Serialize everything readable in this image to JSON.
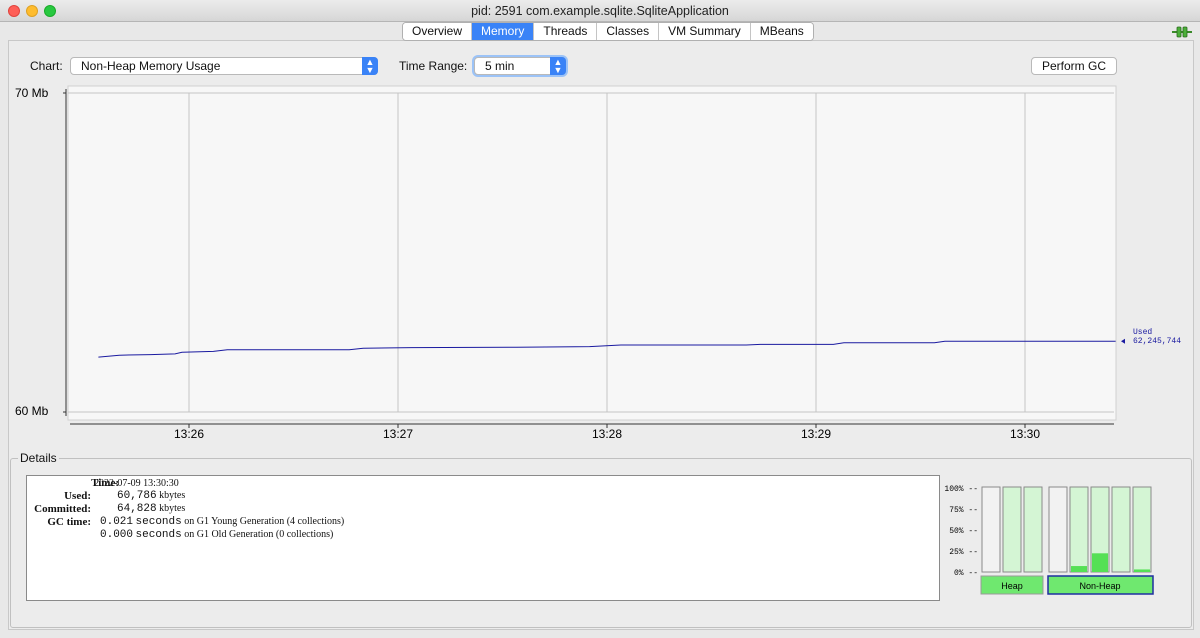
{
  "window": {
    "title": "pid: 2591 com.example.sqlite.SqliteApplication"
  },
  "tabs": [
    {
      "label": "Overview",
      "active": false
    },
    {
      "label": "Memory",
      "active": true
    },
    {
      "label": "Threads",
      "active": false
    },
    {
      "label": "Classes",
      "active": false
    },
    {
      "label": "VM Summary",
      "active": false
    },
    {
      "label": "MBeans",
      "active": false
    }
  ],
  "controls": {
    "chart_label": "Chart:",
    "chart_value": "Non-Heap Memory Usage",
    "time_range_label": "Time Range:",
    "time_range_value": "5 min",
    "perform_gc": "Perform GC"
  },
  "chart_data": {
    "type": "line",
    "y_min_label": "60 Mb",
    "y_max_label": "70 Mb",
    "ylim": [
      60,
      70
    ],
    "x_ticks": [
      "13:26",
      "13:27",
      "13:28",
      "13:29",
      "13:30"
    ],
    "series": [
      {
        "name": "Used",
        "color": "#1a1aa0",
        "last_value_label": "62,245,744",
        "points": [
          [
            "13:25:34",
            61.72
          ],
          [
            "13:25:40",
            61.78
          ],
          [
            "13:25:49",
            61.8
          ],
          [
            "13:25:56",
            61.82
          ],
          [
            "13:25:58",
            61.87
          ],
          [
            "13:26:07",
            61.9
          ],
          [
            "13:26:11",
            61.95
          ],
          [
            "13:26:30",
            61.95
          ],
          [
            "13:26:46",
            61.95
          ],
          [
            "13:26:50",
            62.0
          ],
          [
            "13:27:04",
            62.02
          ],
          [
            "13:27:34",
            62.03
          ],
          [
            "13:27:55",
            62.05
          ],
          [
            "13:28:04",
            62.1
          ],
          [
            "13:28:40",
            62.1
          ],
          [
            "13:28:44",
            62.12
          ],
          [
            "13:29:05",
            62.12
          ],
          [
            "13:29:08",
            62.17
          ],
          [
            "13:29:34",
            62.17
          ],
          [
            "13:29:37",
            62.22
          ],
          [
            "13:30:26",
            62.22
          ]
        ]
      }
    ],
    "grid": true
  },
  "details": {
    "legend": "Details",
    "time_label": "Time:",
    "time_value": "2022-07-09 13:30:30",
    "used_label": "Used:",
    "used_value": "60,786",
    "used_unit": "kbytes",
    "committed_label": "Committed:",
    "committed_value": "64,828",
    "committed_unit": "kbytes",
    "gc_label": "GC time:",
    "gc_rows": [
      {
        "value": "0.021",
        "unit": "seconds",
        "text": "on G1 Young Generation (4 collections)"
      },
      {
        "value": "0.000",
        "unit": "seconds",
        "text": "on G1 Old Generation (0 collections)"
      }
    ]
  },
  "pool_bars": {
    "y_labels": [
      "100% --",
      "75% --",
      "50% --",
      "25% --",
      "0% --"
    ],
    "heap_label": "Heap",
    "nonheap_label": "Non-Heap",
    "heap": [
      0,
      0,
      0
    ],
    "nonheap": [
      0,
      0.07,
      0.22,
      0,
      0.03
    ],
    "fill_color": "#55e055",
    "bg_color": "#d4f5d4"
  }
}
